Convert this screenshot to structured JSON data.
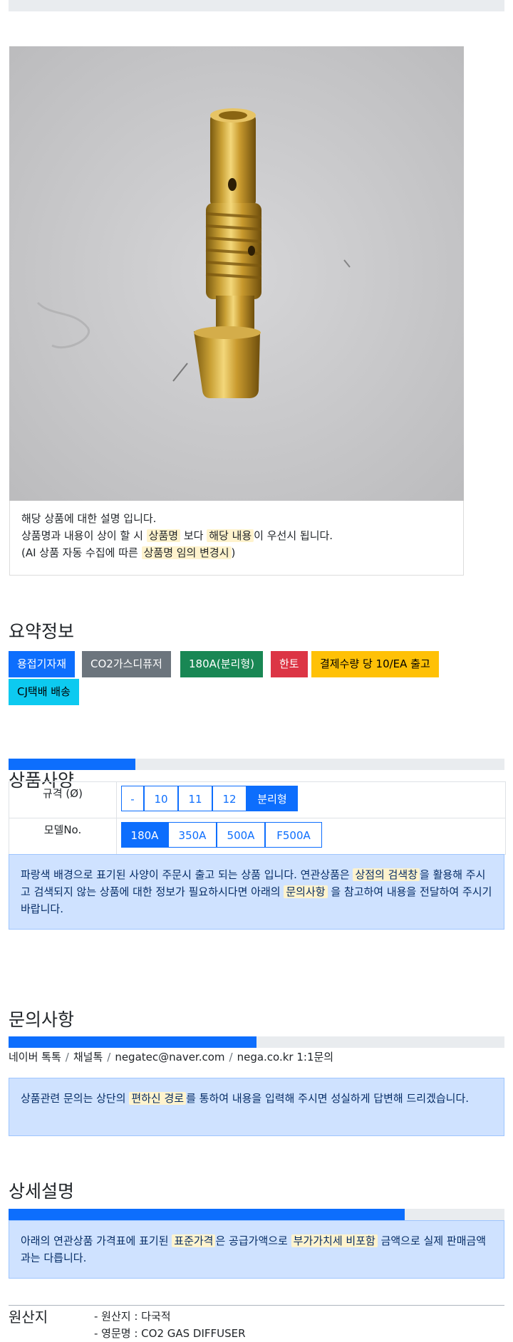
{
  "notice": {
    "line1": "해당 상품에 대한 설명 입니다.",
    "line2_a": "상품명과 내용이 상이 할 시 ",
    "line2_hl1": "상품명",
    "line2_b": " 보다 ",
    "line2_hl2": "해당 내용",
    "line2_c": "이 우선시 됩니다.",
    "line3_a": "(AI 상품 자동 수집에 따른 ",
    "line3_hl": "상품명 임의 변경시",
    "line3_b": ")"
  },
  "summary": {
    "title": "요약정보",
    "badges": [
      {
        "label": "용접기자재",
        "color": "#0d6efd"
      },
      {
        "label": "CO2가스디퓨저",
        "color": "#6c757d"
      },
      {
        "label": "180A(분리형)",
        "color": "#198754"
      },
      {
        "label": "한토",
        "color": "#dc3545"
      },
      {
        "label": "결제수량 당 10/EA 출고",
        "color": "#ffc107"
      },
      {
        "label": "CJ택배 배송",
        "color": "#0dcaf0"
      }
    ]
  },
  "spec": {
    "progress": 0.25,
    "title": "상품사양",
    "rows": [
      {
        "label": "규격 (Ø)",
        "options": [
          "-",
          "10",
          "11",
          "12",
          "분리형"
        ],
        "selected": "분리형"
      },
      {
        "label": "모델No.",
        "options": [
          "180A",
          "350A",
          "500A",
          "F500A"
        ],
        "selected": "180A"
      }
    ],
    "alert": {
      "a": "파랑색 배경으로 표기된 사양이 주문시 출고 되는 상품 입니다. 연관상품은 ",
      "hl1": "상점의 검색창",
      "b": "을 활용해 주시고 검색되지 않는 상품에 대한 정보가 필요하시다면 아래의 ",
      "hl2": "문의사항",
      "c": " 을 참고하여 내용을 전달하여 주시기 바랍니다."
    }
  },
  "inquiry": {
    "title": "문의사항",
    "progress": 0.5,
    "links": [
      "네이버 톡톡",
      "채널톡",
      "negatec@naver.com",
      "nega.co.kr 1:1문의"
    ],
    "separator": "/",
    "alert": {
      "a": "상품관련 문의는 상단의 ",
      "hl": "편하신 경로",
      "b": "를 통하여 내용을 입력해 주시면 성실하게 답변해 드리겠습니다."
    }
  },
  "detail": {
    "title": "상세설명",
    "progress": 0.8,
    "alert": {
      "a": "아래의 연관상품 가격표에 표기된 ",
      "hl1": "표준가격",
      "b": "은 공급가액으로 ",
      "hl2": "부가가치세 비포함",
      "c": " 금액으로 실제 판매금액과는 다릅니다."
    }
  },
  "origin": {
    "label": "원산지",
    "items": [
      "- 원산지 : 다국적",
      "- 영문명 : CO2 GAS DIFFUSER"
    ]
  }
}
